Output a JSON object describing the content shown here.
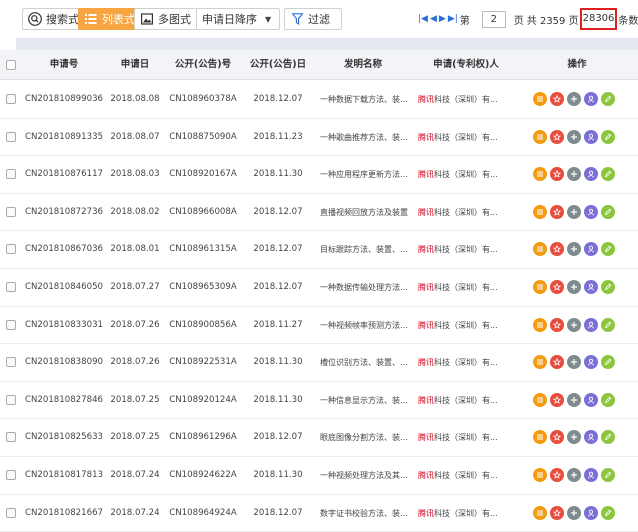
{
  "toolbar": {
    "search_view_label": "搜索式",
    "list_view_label": "列表式",
    "multi_view_label": "多图式",
    "sort_label": "申请日降序",
    "filter_label": "过滤"
  },
  "pager": {
    "prefix": "第",
    "current_page": "2",
    "page_word": "页",
    "total_text": "共 2359 页",
    "total_records": "28306",
    "records_suffix": "条数据"
  },
  "table": {
    "headers": [
      "申请号",
      "申请日",
      "公开(公告)号",
      "公开(公告)日",
      "发明名称",
      "申请(专利权)人",
      "操作"
    ],
    "rows": [
      {
        "app_no": "CN201810899036",
        "app_date": "2018.08.08",
        "pub_no": "CN108960378A",
        "pub_date": "2018.12.07",
        "title": "一种数据下载方法、装...",
        "applicant_hl": "腾讯",
        "applicant_rest": "科技（深圳）有..."
      },
      {
        "app_no": "CN201810891335",
        "app_date": "2018.08.07",
        "pub_no": "CN108875090A",
        "pub_date": "2018.11.23",
        "title": "一种歌曲推荐方法、装...",
        "applicant_hl": "腾讯",
        "applicant_rest": "科技（深圳）有..."
      },
      {
        "app_no": "CN201810876117",
        "app_date": "2018.08.03",
        "pub_no": "CN108920167A",
        "pub_date": "2018.11.30",
        "title": "一种应用程序更新方法...",
        "applicant_hl": "腾讯",
        "applicant_rest": "科技（深圳）有..."
      },
      {
        "app_no": "CN201810872736",
        "app_date": "2018.08.02",
        "pub_no": "CN108966008A",
        "pub_date": "2018.12.07",
        "title": "直播视频回放方法及装置",
        "applicant_hl": "腾讯",
        "applicant_rest": "科技（深圳）有..."
      },
      {
        "app_no": "CN201810867036",
        "app_date": "2018.08.01",
        "pub_no": "CN108961315A",
        "pub_date": "2018.12.07",
        "title": "目标跟踪方法、装置、...",
        "applicant_hl": "腾讯",
        "applicant_rest": "科技（深圳）有..."
      },
      {
        "app_no": "CN201810846050",
        "app_date": "2018.07.27",
        "pub_no": "CN108965309A",
        "pub_date": "2018.12.07",
        "title": "一种数据传输处理方法...",
        "applicant_hl": "腾讯",
        "applicant_rest": "科技（深圳）有..."
      },
      {
        "app_no": "CN201810833031",
        "app_date": "2018.07.26",
        "pub_no": "CN108900856A",
        "pub_date": "2018.11.27",
        "title": "一种视频帧率预测方法...",
        "applicant_hl": "腾讯",
        "applicant_rest": "科技（深圳）有..."
      },
      {
        "app_no": "CN201810838090",
        "app_date": "2018.07.26",
        "pub_no": "CN108922531A",
        "pub_date": "2018.11.30",
        "title": "槽位识别方法、装置、...",
        "applicant_hl": "腾讯",
        "applicant_rest": "科技（深圳）有..."
      },
      {
        "app_no": "CN201810827846",
        "app_date": "2018.07.25",
        "pub_no": "CN108920124A",
        "pub_date": "2018.11.30",
        "title": "一种信息显示方法、装...",
        "applicant_hl": "腾讯",
        "applicant_rest": "科技（深圳）有..."
      },
      {
        "app_no": "CN201810825633",
        "app_date": "2018.07.25",
        "pub_no": "CN108961296A",
        "pub_date": "2018.12.07",
        "title": "眼底图像分割方法、装...",
        "applicant_hl": "腾讯",
        "applicant_rest": "科技（深圳）有..."
      },
      {
        "app_no": "CN201810817813",
        "app_date": "2018.07.24",
        "pub_no": "CN108924622A",
        "pub_date": "2018.11.30",
        "title": "一种视频处理方法及其...",
        "applicant_hl": "腾讯",
        "applicant_rest": "科技（深圳）有..."
      },
      {
        "app_no": "CN201810821667",
        "app_date": "2018.07.24",
        "pub_no": "CN108964924A",
        "pub_date": "2018.12.07",
        "title": "数字证书校验方法、装...",
        "applicant_hl": "腾讯",
        "applicant_rest": "科技（深圳）有..."
      }
    ]
  },
  "action_colors": {
    "list": "#f39c12",
    "star": "#e74c3c",
    "plus": "#7f8c8d",
    "user": "#7b6fd6",
    "edit": "#8cc63f"
  },
  "icons": [
    "search-icon",
    "list-icon",
    "image-icon",
    "filter-icon",
    "first-page-icon",
    "prev-page-icon",
    "next-page-icon",
    "last-page-icon",
    "list-action-icon",
    "star-action-icon",
    "plus-action-icon",
    "user-action-icon",
    "edit-action-icon"
  ]
}
